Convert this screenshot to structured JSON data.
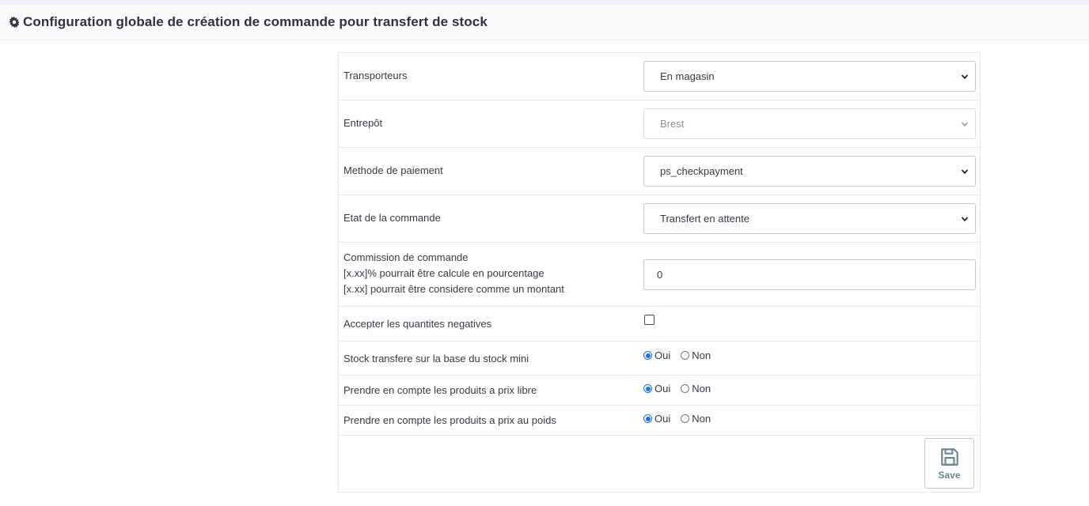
{
  "header": {
    "title": "Configuration globale de création de commande pour transfert de stock",
    "icon": "gear-icon"
  },
  "form": {
    "transporteurs": {
      "label": "Transporteurs",
      "value": "En magasin"
    },
    "entrepot": {
      "label": "Entrepôt",
      "value": "Brest"
    },
    "paiement": {
      "label": "Methode de paiement",
      "value": "ps_checkpayment"
    },
    "etat": {
      "label": "Etat de la commande",
      "value": "Transfert en attente"
    },
    "commission": {
      "label_1": "Commission de commande",
      "label_2": "[x.xx]% pourrait être calcule en pourcentage",
      "label_3": "[x.xx] pourrait être considere comme un montant",
      "value": "0"
    },
    "negatives": {
      "label": "Accepter les quantites negatives",
      "checked": false
    },
    "stock_mini": {
      "label": "Stock transfere sur la base du stock mini",
      "selected": "Oui"
    },
    "prix_libre": {
      "label": "Prendre en compte les produits a prix libre",
      "selected": "Oui"
    },
    "prix_poids": {
      "label": "Prendre en compte les produits a prix au poids",
      "selected": "Oui"
    },
    "radio_yes": "Oui",
    "radio_no": "Non"
  },
  "save_button": {
    "label": "Save",
    "icon": "floppy-disk-icon"
  },
  "colors": {
    "accent": "#1a73e8",
    "border": "#bbcdd2",
    "header_bg": "#f8fafb"
  }
}
